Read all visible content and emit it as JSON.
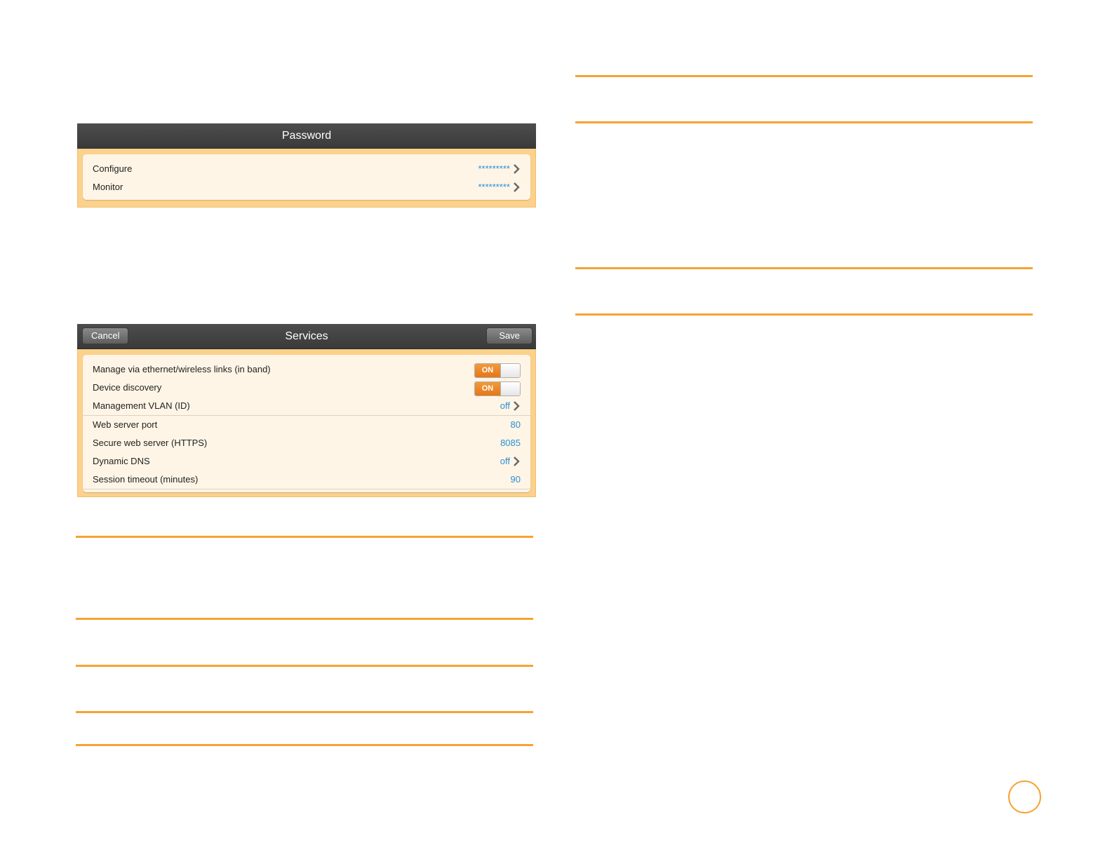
{
  "password_panel": {
    "title": "Password",
    "rows": [
      {
        "label": "Configure",
        "value": "*********"
      },
      {
        "label": "Monitor",
        "value": "*********"
      }
    ]
  },
  "services_panel": {
    "title": "Services",
    "cancel_label": "Cancel",
    "save_label": "Save",
    "rows": [
      {
        "label": "Manage via ethernet/wireless links (in band)",
        "toggle": "ON"
      },
      {
        "label": "Device discovery",
        "toggle": "ON"
      },
      {
        "label": "Management VLAN (ID)",
        "value": "off"
      },
      {
        "label": "Web server port",
        "value": "80"
      },
      {
        "label": "Secure web server (HTTPS)",
        "value": "8085"
      },
      {
        "label": "Dynamic DNS",
        "value": "off"
      },
      {
        "label": "Session timeout (minutes)",
        "value": "90"
      }
    ]
  },
  "icons": {
    "disclosure": "chevron-right-icon"
  },
  "colors": {
    "accent": "#f7a234",
    "value_text": "#2b8fd6",
    "panel_bg": "#fcd18c",
    "header_bg": "#444444"
  }
}
